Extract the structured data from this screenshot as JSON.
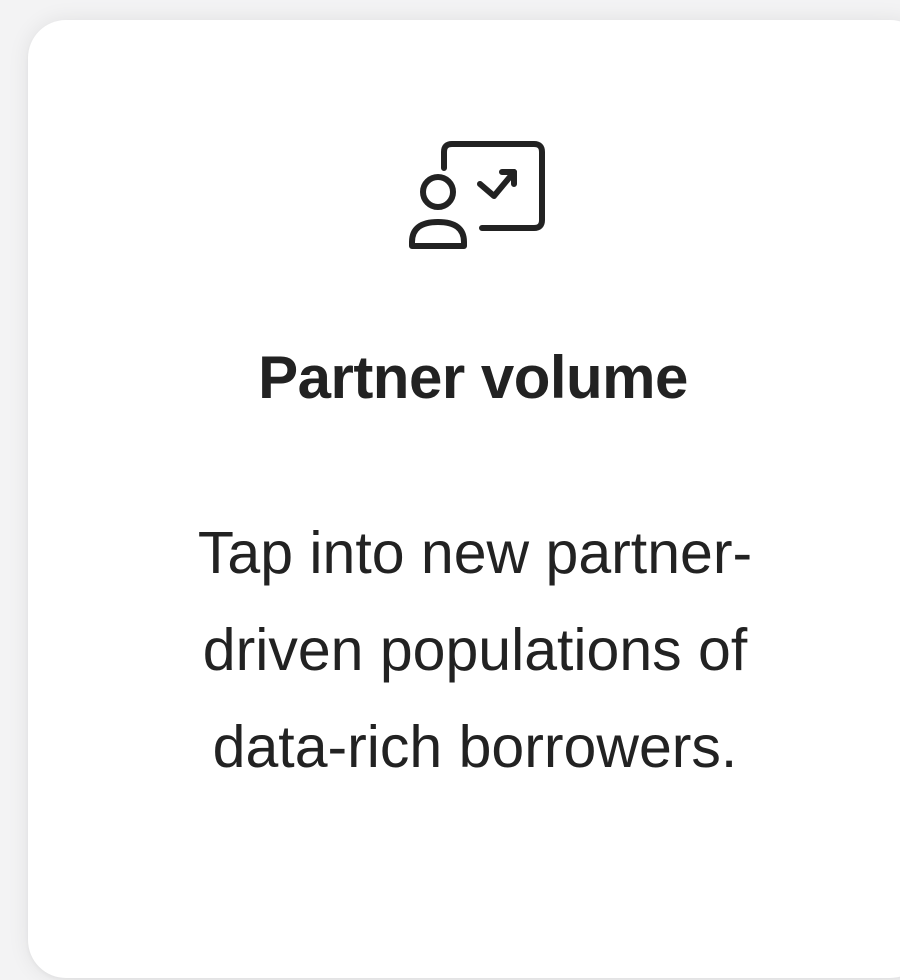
{
  "card": {
    "icon": "presentation-user-trend-icon",
    "title": "Partner volume",
    "description": "Tap into new partner-driven populations of data-rich borrowers."
  },
  "colors": {
    "text": "#222222",
    "card_background": "#ffffff",
    "page_background": "#f3f3f4"
  }
}
